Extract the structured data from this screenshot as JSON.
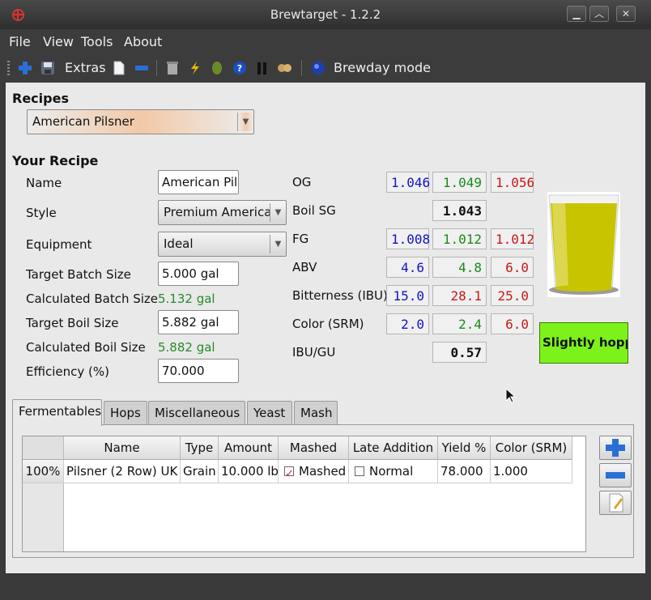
{
  "window": {
    "title": "Brewtarget - 1.2.2",
    "min_icon": "minimize-icon",
    "max_icon": "maximize-icon",
    "close_icon": "close-icon"
  },
  "menu": {
    "file": "File",
    "view": "View",
    "tools": "Tools",
    "about": "About"
  },
  "toolbar": {
    "extras": "Extras",
    "brewday": "Brewday mode"
  },
  "recipes": {
    "heading": "Recipes",
    "selected": "American Pilsner"
  },
  "your_recipe": {
    "heading": "Your Recipe",
    "name_label": "Name",
    "name_value": "American Pilsner",
    "style_label": "Style",
    "style_value": "Premium American Lager",
    "equipment_label": "Equipment",
    "equipment_value": "Ideal",
    "target_batch_label": "Target Batch Size",
    "target_batch_value": "5.000 gal",
    "calc_batch_label": "Calculated Batch Size",
    "calc_batch_value": "5.132 gal",
    "target_boil_label": "Target Boil Size",
    "target_boil_value": "5.882 gal",
    "calc_boil_label": "Calculated Boil Size",
    "calc_boil_value": "5.882 gal",
    "efficiency_label": "Efficiency (%)",
    "efficiency_value": "70.000"
  },
  "stats": {
    "og": {
      "label": "OG",
      "min": "1.046",
      "value": "1.049",
      "max": "1.056"
    },
    "boil_sg": {
      "label": "Boil SG",
      "value": "1.043"
    },
    "fg": {
      "label": "FG",
      "min": "1.008",
      "value": "1.012",
      "max": "1.012"
    },
    "abv": {
      "label": "ABV",
      "min": "4.6",
      "value": "4.8",
      "max": "6.0"
    },
    "ibu": {
      "label": "Bitterness (IBU)",
      "min": "15.0",
      "value": "28.1",
      "max": "25.0"
    },
    "srm": {
      "label": "Color (SRM)",
      "min": "2.0",
      "value": "2.4",
      "max": "6.0"
    },
    "ibugu": {
      "label": "IBU/GU",
      "value": "0.57"
    }
  },
  "hoppiness": "Slightly hoppy",
  "colors": {
    "hoppy_bg": "#7cf21a",
    "beer": "#c9c400",
    "min_text": "#1212c8",
    "in_range": "#1a8a1a",
    "max_text": "#c81818"
  },
  "tabs": [
    "Fermentables",
    "Hops",
    "Miscellaneous",
    "Yeast",
    "Mash"
  ],
  "fermentables": {
    "columns": [
      "Name",
      "Type",
      "Amount",
      "Mashed",
      "Late Addition",
      "Yield %",
      "Color (SRM)"
    ],
    "rows": [
      {
        "pct": "100%",
        "name": "Pilsner (2 Row) UK",
        "type": "Grain",
        "amount": "10.000 lb",
        "mashed": "Mashed",
        "late": "Normal",
        "yield": "78.000",
        "color": "1.000"
      }
    ]
  }
}
